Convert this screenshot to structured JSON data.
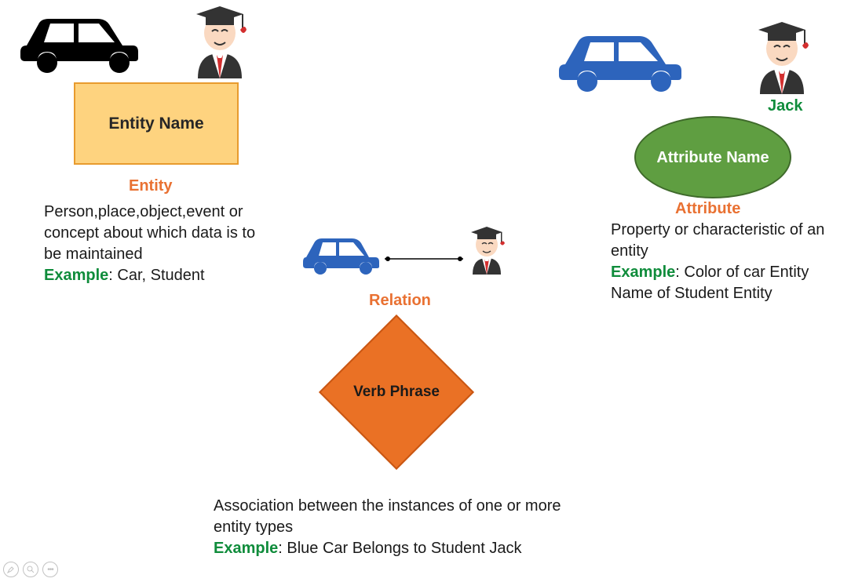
{
  "entity": {
    "box_label": "Entity Name",
    "title": "Entity",
    "desc": "Person,place,object,event or concept about which data is to be maintained",
    "example_label": "Example",
    "example_text": ": Car, Student"
  },
  "attribute": {
    "jack_label": "Jack",
    "ellipse_label": "Attribute Name",
    "title": "Attribute",
    "desc": "Property or characteristic of an entity",
    "example_label": "Example",
    "example_text": ": Color of car Entity Name of Student Entity"
  },
  "relation": {
    "title": "Relation",
    "diamond_label": "Verb Phrase",
    "desc": "Association between the instances of one or more entity types",
    "example_label": "Example",
    "example_text": ": Blue Car Belongs to Student Jack"
  }
}
